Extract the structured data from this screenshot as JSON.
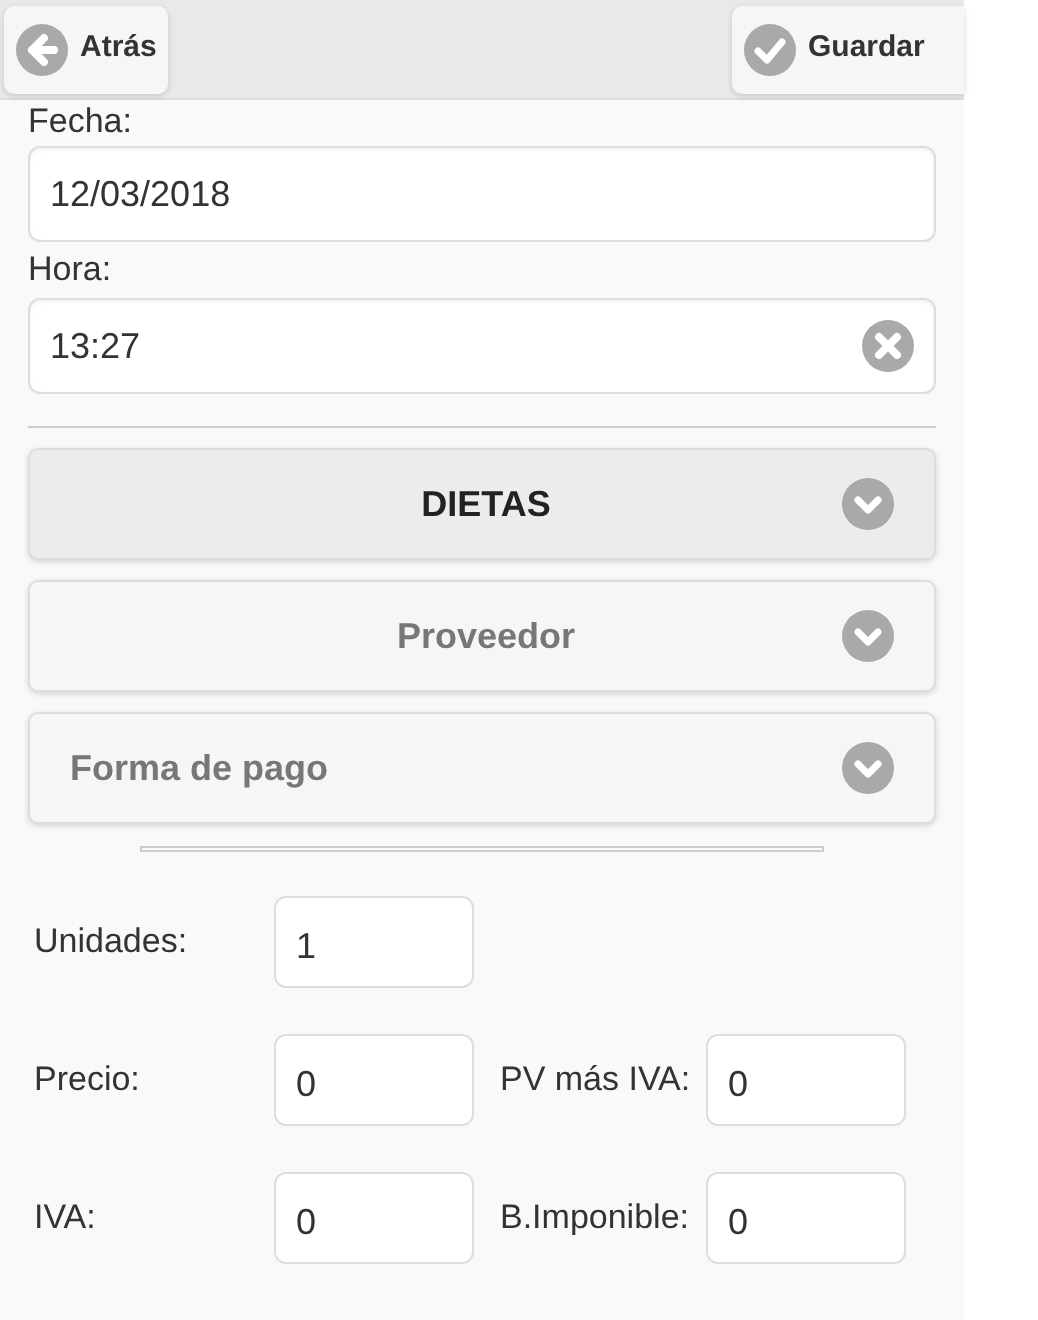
{
  "header": {
    "back_button": "Atrás",
    "save_button": "Guardar"
  },
  "fields": [
    {
      "label": "Fecha:",
      "value": "12/03/2018",
      "clearable": false
    },
    {
      "label": "Hora:",
      "value": "13:27",
      "clearable": true
    }
  ],
  "sections": [
    {
      "title": "DIETAS",
      "kind": "centered",
      "active": true
    },
    {
      "title": "Proveedor",
      "kind": "centered",
      "active": false
    },
    {
      "title": "Forma de pago",
      "kind": "plain",
      "active": false
    }
  ],
  "amounts": [
    [
      {
        "label": "Unidades:",
        "value": "1"
      }
    ],
    [
      {
        "label": "Precio:",
        "value": "0"
      },
      {
        "label": "PV más IVA:",
        "value": "0"
      }
    ],
    [
      {
        "label": "IVA:",
        "value": "0"
      },
      {
        "label": "B.Imponible:",
        "value": "0"
      }
    ]
  ]
}
